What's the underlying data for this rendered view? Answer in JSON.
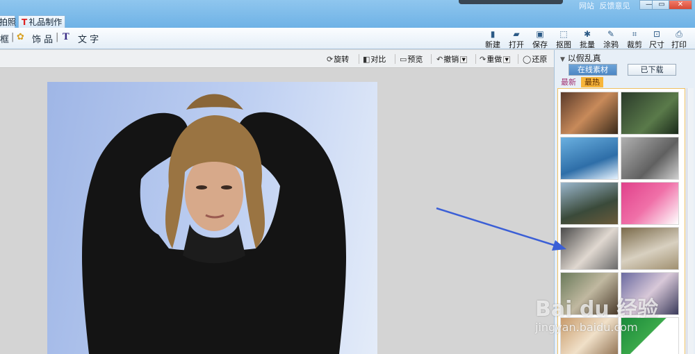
{
  "window": {
    "links": [
      "网站",
      "反馈意见"
    ],
    "controls": {
      "minimize": "—",
      "restore": "▭",
      "close": "✕"
    }
  },
  "tabs": [
    {
      "label": "拍照"
    },
    {
      "label": "礼品制作",
      "icon": "gift-t-icon"
    }
  ],
  "toolbar": {
    "frame_label": "框",
    "ornament_label": "饰 品",
    "text_icon": "T",
    "text_label": "文 字",
    "tools": [
      {
        "label": "新建",
        "icon": "new-file-icon"
      },
      {
        "label": "打开",
        "icon": "folder-open-icon"
      },
      {
        "label": "保存",
        "icon": "save-icon"
      },
      {
        "label": "抠图",
        "icon": "cutout-icon"
      },
      {
        "label": "批量",
        "icon": "batch-icon"
      },
      {
        "label": "涂鸦",
        "icon": "doodle-icon"
      },
      {
        "label": "裁剪",
        "icon": "crop-icon"
      },
      {
        "label": "尺寸",
        "icon": "resize-icon"
      },
      {
        "label": "打印",
        "icon": "print-icon"
      }
    ]
  },
  "editbar": {
    "rotate": "旋转",
    "compare": "对比",
    "preview": "预览",
    "undo": "撤销",
    "redo": "重做",
    "restore": "还原"
  },
  "panel": {
    "header": "以假乱真",
    "tab_online": "在线素材",
    "tab_downloaded": "已下载",
    "subtab_new": "最新",
    "subtab_hot": "最热"
  },
  "watermark": {
    "logo": "Bai du 经验",
    "url": "jingyan.baidu.com"
  },
  "colors": {
    "titlebar": "#7cbbe9",
    "accent": "#4c86c4",
    "hot": "#f7b53a",
    "arrow": "#3b5fd6"
  }
}
